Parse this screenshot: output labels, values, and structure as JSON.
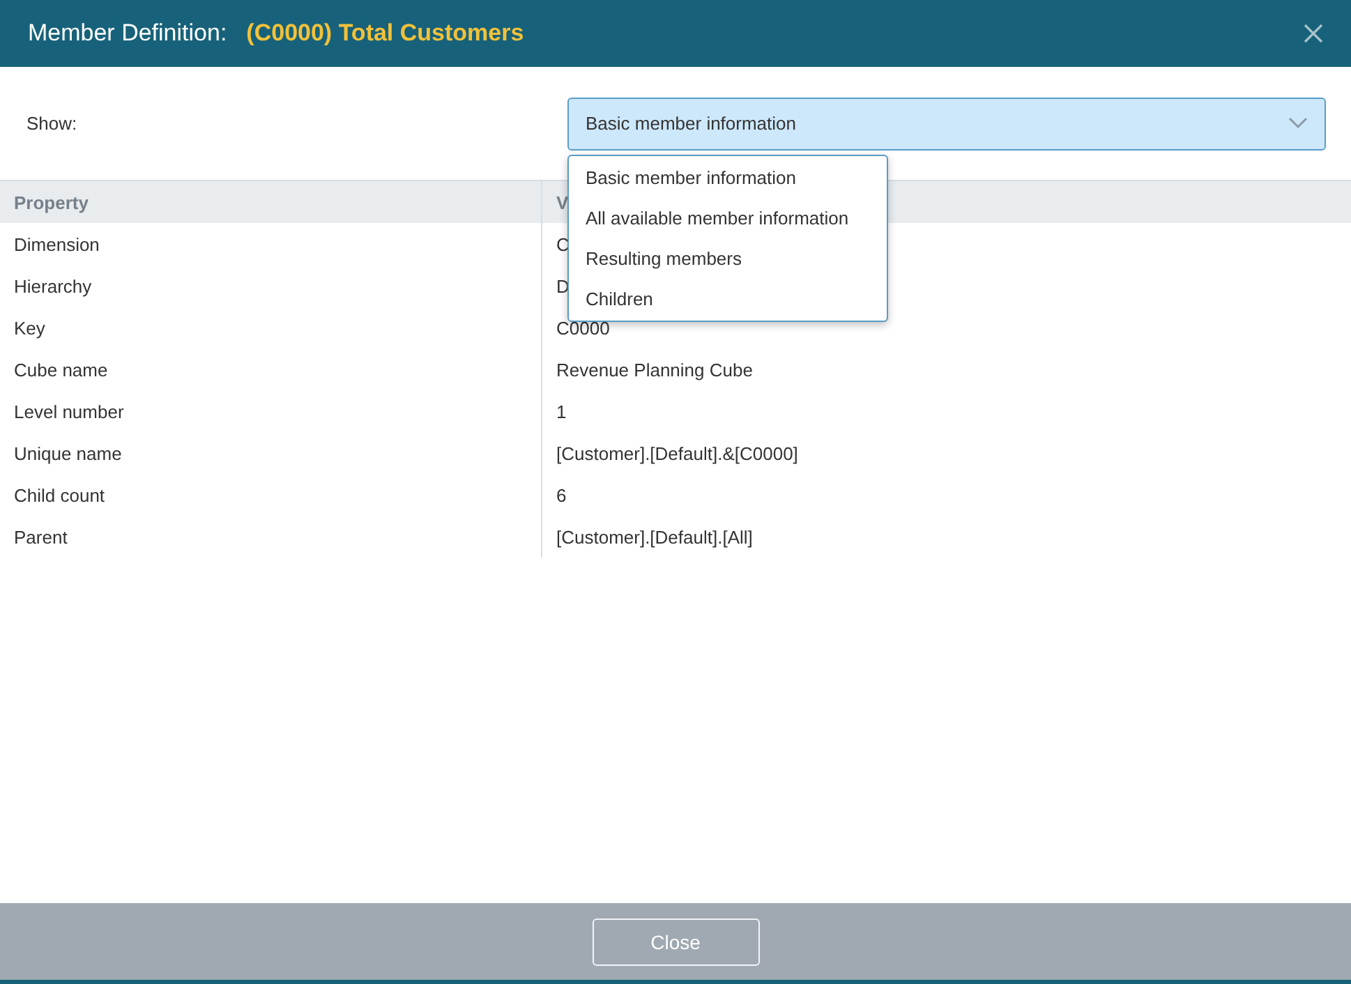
{
  "window": {
    "title": "Member Definition:",
    "subtitle": "(C0000) Total Customers"
  },
  "show": {
    "label": "Show:",
    "value": "Basic member information",
    "expanded": true,
    "options": [
      {
        "label": "Basic member information"
      },
      {
        "label": "All available member information"
      },
      {
        "label": "Resulting members"
      },
      {
        "label": "Children"
      }
    ]
  },
  "table": {
    "columns": [
      "Property",
      "V"
    ],
    "rows": [
      [
        "Dimension",
        "C"
      ],
      [
        "Hierarchy",
        "D"
      ],
      [
        "Key",
        "C0000"
      ],
      [
        "Cube name",
        "Revenue Planning Cube"
      ],
      [
        "Level number",
        "1"
      ],
      [
        "Unique name",
        "[Customer].[Default].&[C0000]"
      ],
      [
        "Child count",
        "6"
      ],
      [
        "Parent",
        "[Customer].[Default].[All]"
      ]
    ]
  },
  "buttons": [
    "Close"
  ]
}
